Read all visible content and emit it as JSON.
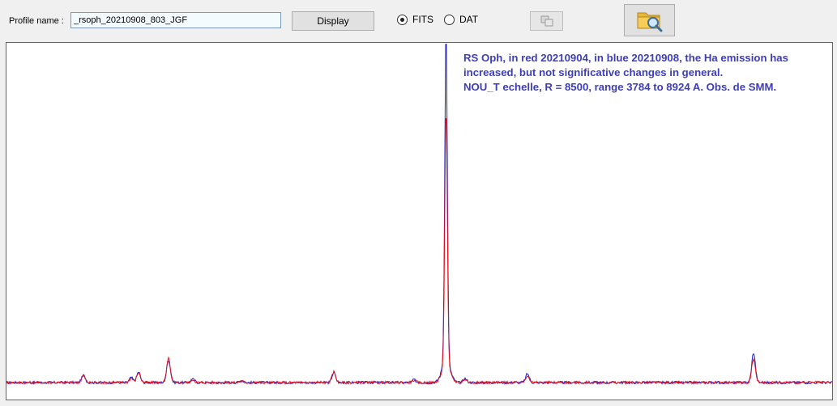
{
  "toolbar": {
    "profile_label": "Profile name :",
    "profile_value": "_rsoph_20210908_803_JGF",
    "display_label": "Display",
    "format_options": [
      {
        "label": "FITS",
        "selected": true
      },
      {
        "label": "DAT",
        "selected": false
      }
    ],
    "copy_icon": "copy-windows-icon",
    "open_icon": "folder-search-icon",
    "copy_enabled": false
  },
  "chart_data": {
    "type": "line",
    "annotation": [
      "RS Oph, in red 20210904, in blue 20210908, the Ha emission has",
      "increased, but not significative changes in general.",
      "NOU_T echelle, R = 8500, range 3784 to 8924 A.    Obs. de SMM."
    ],
    "series": [
      {
        "color": "#2020c8",
        "peaks": [
          [
            95,
            0.022
          ],
          [
            154,
            0.015
          ],
          [
            163,
            0.032
          ],
          [
            200,
            0.068
          ],
          [
            230,
            0.01
          ],
          [
            290,
            0.006
          ],
          [
            404,
            0.03
          ],
          [
            503,
            0.008
          ],
          [
            542.5,
            1.0
          ],
          [
            566,
            0.012
          ],
          [
            643,
            0.026
          ],
          [
            922,
            0.09
          ]
        ]
      },
      {
        "color": "#e8101a",
        "peaks": [
          [
            95,
            0.02
          ],
          [
            154,
            0.013
          ],
          [
            163,
            0.03
          ],
          [
            200,
            0.072
          ],
          [
            230,
            0.009
          ],
          [
            290,
            0.005
          ],
          [
            404,
            0.032
          ],
          [
            503,
            0.007
          ],
          [
            542.5,
            0.78
          ],
          [
            566,
            0.01
          ],
          [
            643,
            0.022
          ],
          [
            922,
            0.072
          ]
        ]
      }
    ],
    "baseline": 0.0,
    "grid": false,
    "legend": "none"
  }
}
